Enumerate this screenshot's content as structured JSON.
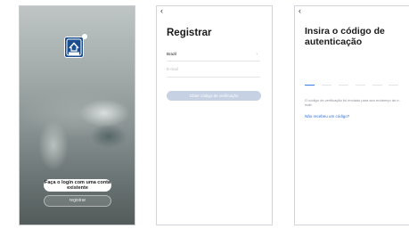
{
  "screen1": {
    "login_button": "Faça o login com uma conta existente",
    "register_button": "registrar"
  },
  "screen2": {
    "back_icon": "chevron-left-icon",
    "title": "Registrar",
    "country_value": "Brazil",
    "email_placeholder": "E-mail",
    "verify_button": "Obter código de verificação"
  },
  "screen3": {
    "back_icon": "chevron-left-icon",
    "title": "Insira o código de autenticação",
    "info_text": "O código de verificação foi enviado para seu endereço de e-mail:",
    "resend_link": "Não recebeu um código?",
    "code_digits": 6
  },
  "colors": {
    "brand_blue": "#1a4e8e",
    "accent": "#3b7ae8",
    "disabled_button": "#c6d1e4"
  }
}
